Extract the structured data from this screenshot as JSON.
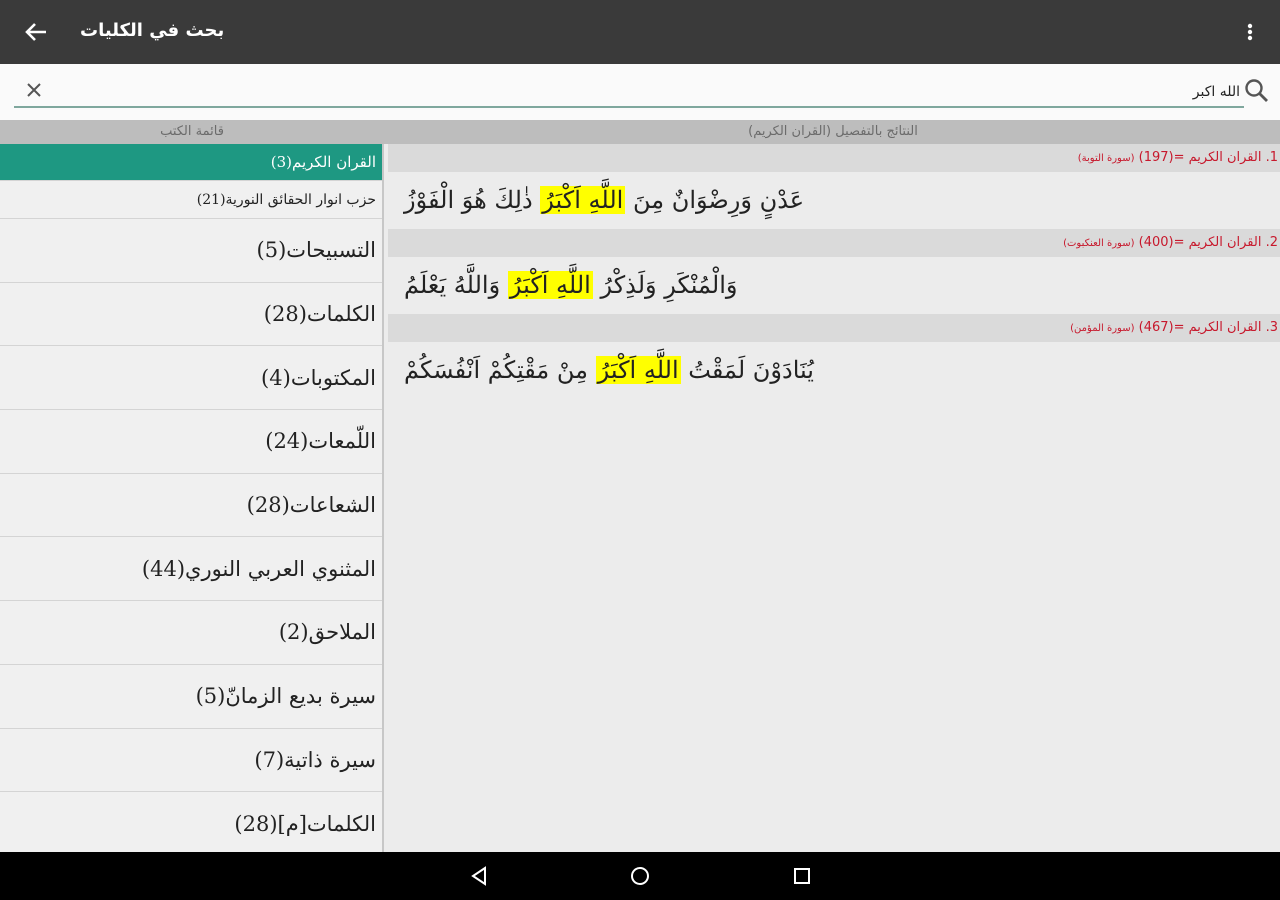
{
  "appbar": {
    "title": "بحث في الكليات",
    "icons": {
      "back": "back-arrow-icon",
      "more": "more-vert-icon"
    }
  },
  "search": {
    "value": "الله اكبر",
    "placeholder": ""
  },
  "headers": {
    "books_header": "قائمة الكتب",
    "results_header": "النتائج بالتفصيل (القران الكريم)"
  },
  "books": [
    {
      "label": "القران الكريم(3)",
      "active": true
    },
    {
      "label": "حزب انوار الحقائق النورية(21)"
    },
    {
      "label": "التسبيحات(5)"
    },
    {
      "label": "الكلمات(28)"
    },
    {
      "label": "المكتوبات(4)"
    },
    {
      "label": "اللّمعات(24)"
    },
    {
      "label": "الشعاعات(28)"
    },
    {
      "label": "المثنوي العربي النوري(44)"
    },
    {
      "label": "الملاحق(2)"
    },
    {
      "label": "سيرة بديع الزمانّ(5)"
    },
    {
      "label": "سيرة ذاتية(7)"
    },
    {
      "label": "الكلمات[م](28)"
    }
  ],
  "results": [
    {
      "header": "1. القران الكريم =(197)",
      "source": "(سورة التوبة)",
      "before": "عَدْنٍ وَرِضْوَانٌ مِنَ",
      "highlight": "اللَّهِ اَكْبَرُ",
      "after": "ذٰلِكَ هُوَ الْفَوْزُ"
    },
    {
      "header": "2. القران الكريم =(400)",
      "source": "(سورة العنكبوت)",
      "before": "وَالْمُنْكَرِ وَلَذِكْرُ",
      "highlight": "اللَّهِ اَكْبَرُ",
      "after": "وَاللَّهُ يَعْلَمُ"
    },
    {
      "header": "3. القران الكريم =(467)",
      "source": "(سورة المؤمن)",
      "before": "يُنَادَوْنَ لَمَقْتُ",
      "highlight": "اللَّهِ اَكْبَرُ",
      "after": "مِنْ مَقْتِكُمْ اَنْفُسَكُمْ"
    }
  ],
  "colors": {
    "accent": "#1e9882",
    "highlight": "#ffff00",
    "header_red": "#c7182c",
    "appbar": "#3a3a3a"
  },
  "navbar": {
    "icons": [
      "back-triangle-icon",
      "home-circle-icon",
      "recents-square-icon"
    ]
  }
}
